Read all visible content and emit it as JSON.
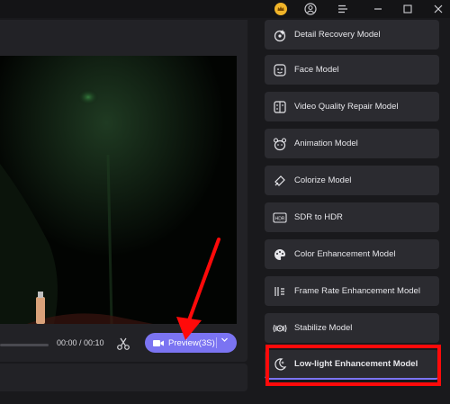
{
  "titlebar": {
    "icons": [
      "crown-icon",
      "user-icon",
      "menu-icon",
      "minimize-icon",
      "maximize-icon",
      "close-icon"
    ],
    "crown_color": "#f0b429"
  },
  "player": {
    "time_display": "00:00 / 00:10",
    "progress": 0,
    "preview_label": "Preview(3S)",
    "accent_color": "#7b74f2"
  },
  "models": [
    {
      "label": "Detail Recovery Model",
      "icon": "detail-recovery-icon"
    },
    {
      "label": "Face Model",
      "icon": "face-icon"
    },
    {
      "label": "Video Quality Repair Model",
      "icon": "video-repair-icon"
    },
    {
      "label": "Animation Model",
      "icon": "animation-icon"
    },
    {
      "label": "Colorize Model",
      "icon": "colorize-icon"
    },
    {
      "label": "SDR to HDR",
      "icon": "hdr-icon",
      "badge": "HDR"
    },
    {
      "label": "Color Enhancement Model",
      "icon": "palette-icon"
    },
    {
      "label": "Frame Rate Enhancement Model",
      "icon": "frame-rate-icon"
    },
    {
      "label": "Stabilize Model",
      "icon": "stabilize-icon"
    },
    {
      "label": "Low-light Enhancement Model",
      "icon": "low-light-icon",
      "selected": true
    }
  ],
  "annotation_color": "#ff0a0a"
}
